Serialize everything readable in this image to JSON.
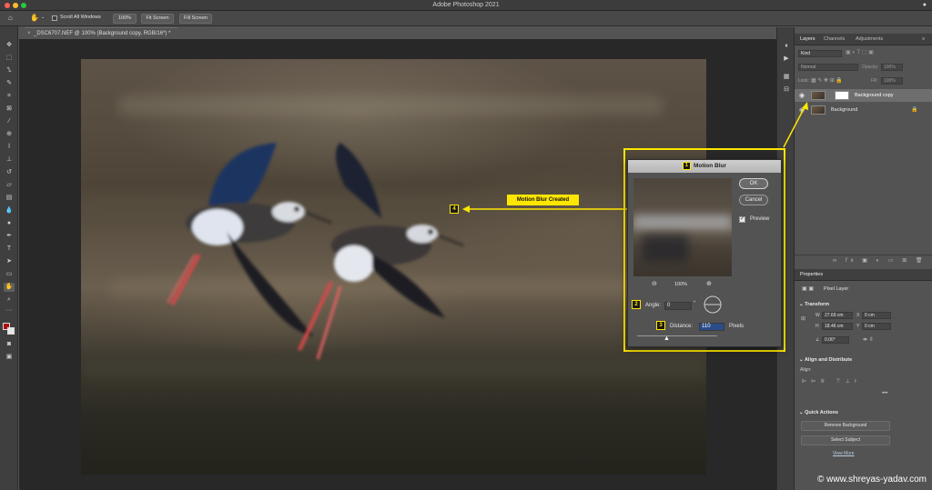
{
  "app": {
    "window_title": "Adobe Photoshop 2021",
    "document_tab": "_DSC6707.NEF @ 100% (Background copy, RGB/16*) *"
  },
  "options_bar": {
    "scroll_all_windows": "Scroll All Windows",
    "zoom_100": "100%",
    "fit_screen": "Fit Screen",
    "fill_screen": "Fill Screen"
  },
  "layers_panel": {
    "tabs": [
      "Layers",
      "Channels",
      "Adjustments"
    ],
    "kind_label": "Kind",
    "blend_mode": "Normal",
    "opacity_label": "Opacity:",
    "opacity_value": "100%",
    "lock_label": "Lock:",
    "fill_label": "Fill:",
    "fill_value": "100%",
    "layers": [
      {
        "name": "Background copy",
        "selected": true
      },
      {
        "name": "Background",
        "selected": false
      }
    ]
  },
  "properties_panel": {
    "title": "Properties",
    "layer_type": "Pixel Layer",
    "transform_label": "Transform",
    "w_label": "W",
    "w_value": "27.69 cm",
    "x_label": "X",
    "x_value": "0 cm",
    "h_label": "H",
    "h_value": "18.46 cm",
    "y_label": "Y",
    "y_value": "0 cm",
    "angle_value": "0.00°",
    "align_label": "Align and Distribute",
    "align_sub": "Align:",
    "quick_actions_label": "Quick Actions",
    "remove_background": "Remove Background",
    "select_subject": "Select Subject",
    "view_more": "View More"
  },
  "motion_blur_dialog": {
    "title": "Motion Blur",
    "ok": "OK",
    "cancel": "Cancel",
    "preview_label": "Preview",
    "preview_checked": true,
    "zoom_level": "100%",
    "angle_label": "Angle:",
    "angle_value": "0",
    "angle_unit": "°",
    "distance_label": "Distance:",
    "distance_value": "110",
    "distance_unit": "Pixels"
  },
  "annotations": {
    "callout_text": "Motion Blur Created",
    "markers": [
      "1",
      "2",
      "3",
      "4"
    ],
    "highlight_color": "#ffe600"
  },
  "watermark": "© www.shreyas-yadav.com",
  "colors": {
    "foreground": "#b01010",
    "background": "#e6e6e6"
  }
}
